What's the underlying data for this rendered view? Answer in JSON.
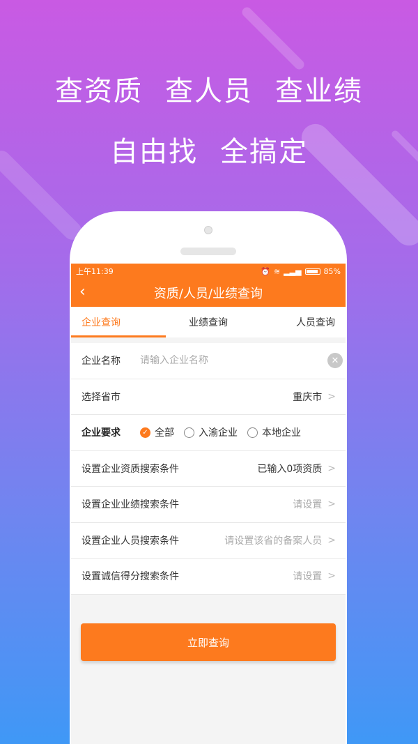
{
  "headline": {
    "line1": [
      "查资质",
      "查人员",
      "查业绩"
    ],
    "line2": [
      "自由找",
      "全搞定"
    ]
  },
  "status": {
    "time": "上午11:39",
    "battery": "85%"
  },
  "nav": {
    "back_icon": "chevron-left-icon",
    "title": "资质/人员/业绩查询"
  },
  "tabs": [
    "企业查询",
    "业绩查询",
    "人员查询"
  ],
  "form": {
    "company_name": {
      "label": "企业名称",
      "placeholder": "请输入企业名称"
    },
    "province": {
      "label": "选择省市",
      "value": "重庆市"
    },
    "requirement": {
      "label": "企业要求",
      "options": [
        "全部",
        "入渝企业",
        "本地企业"
      ],
      "selected": "全部"
    },
    "qualification": {
      "label": "设置企业资质搜索条件",
      "value": "已输入0项资质"
    },
    "performance": {
      "label": "设置企业业绩搜索条件",
      "value": "请设置"
    },
    "personnel": {
      "label": "设置企业人员搜索条件",
      "value": "请设置该省的备案人员"
    },
    "credit": {
      "label": "设置诚信得分搜索条件",
      "value": "请设置"
    }
  },
  "submit_label": "立即查询",
  "colors": {
    "accent": "#fd7a1e"
  }
}
